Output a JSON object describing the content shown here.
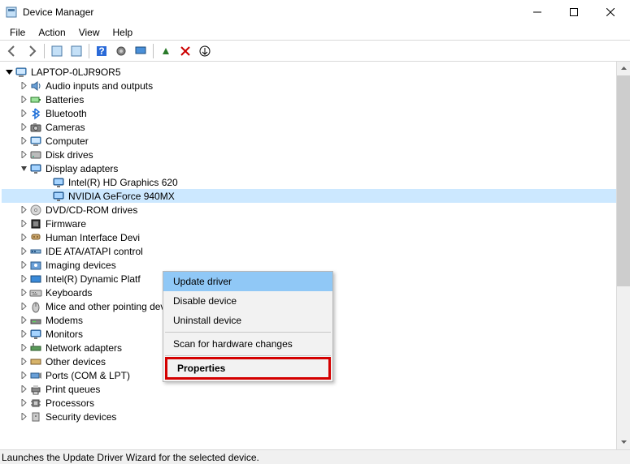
{
  "window": {
    "title": "Device Manager"
  },
  "menubar": [
    "File",
    "Action",
    "View",
    "Help"
  ],
  "root": "LAPTOP-0LJR9OR5",
  "categories": [
    {
      "icon": "audio",
      "label": "Audio inputs and outputs",
      "expanded": false
    },
    {
      "icon": "battery",
      "label": "Batteries",
      "expanded": false
    },
    {
      "icon": "bluetooth",
      "label": "Bluetooth",
      "expanded": false
    },
    {
      "icon": "camera",
      "label": "Cameras",
      "expanded": false
    },
    {
      "icon": "computer",
      "label": "Computer",
      "expanded": false
    },
    {
      "icon": "disk",
      "label": "Disk drives",
      "expanded": false
    },
    {
      "icon": "display",
      "label": "Display adapters",
      "expanded": true,
      "children": [
        {
          "icon": "display",
          "label": "Intel(R) HD Graphics 620",
          "selected": false
        },
        {
          "icon": "display",
          "label": "NVIDIA GeForce 940MX",
          "selected": true
        }
      ]
    },
    {
      "icon": "dvd",
      "label": "DVD/CD-ROM drives",
      "expanded": false
    },
    {
      "icon": "firmware",
      "label": "Firmware",
      "expanded": false
    },
    {
      "icon": "hid",
      "label": "Human Interface Devi",
      "expanded": false
    },
    {
      "icon": "ide",
      "label": "IDE ATA/ATAPI control",
      "expanded": false
    },
    {
      "icon": "imaging",
      "label": "Imaging devices",
      "expanded": false
    },
    {
      "icon": "intel",
      "label": "Intel(R) Dynamic Platf",
      "expanded": false
    },
    {
      "icon": "keyboard",
      "label": "Keyboards",
      "expanded": false
    },
    {
      "icon": "mouse",
      "label": "Mice and other pointing devices",
      "expanded": false
    },
    {
      "icon": "modem",
      "label": "Modems",
      "expanded": false
    },
    {
      "icon": "display",
      "label": "Monitors",
      "expanded": false
    },
    {
      "icon": "network",
      "label": "Network adapters",
      "expanded": false
    },
    {
      "icon": "other",
      "label": "Other devices",
      "expanded": false
    },
    {
      "icon": "port",
      "label": "Ports (COM & LPT)",
      "expanded": false
    },
    {
      "icon": "printer",
      "label": "Print queues",
      "expanded": false
    },
    {
      "icon": "cpu",
      "label": "Processors",
      "expanded": false
    },
    {
      "icon": "security",
      "label": "Security devices",
      "expanded": false
    }
  ],
  "context_menu": {
    "items": [
      "Update driver",
      "Disable device",
      "Uninstall device"
    ],
    "scan": "Scan for hardware changes",
    "properties": "Properties"
  },
  "statusbar": "Launches the Update Driver Wizard for the selected device."
}
